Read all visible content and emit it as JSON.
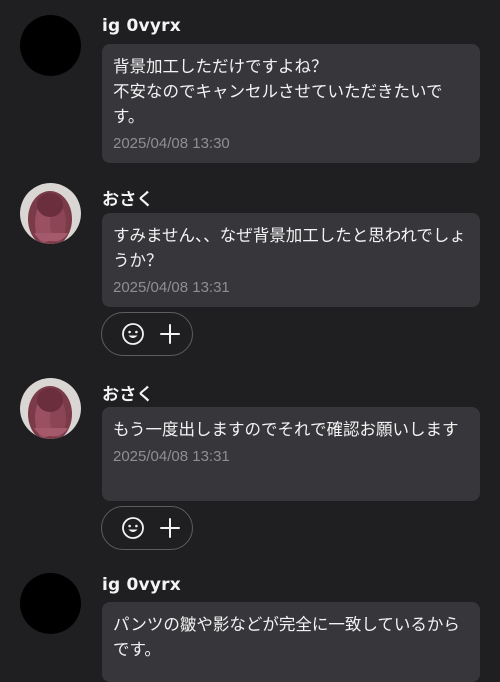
{
  "messages": [
    {
      "sender": "ig 0vyrx",
      "avatar_type": "black-circle",
      "text": "背景加工しただけですよね？\n不安なのでキャンセルさせていただきたいです。",
      "time": "2025/04/08 13:30",
      "reactions": false
    },
    {
      "sender": "おさく",
      "avatar_type": "photo",
      "text": "すみません、、なぜ背景加工したと思われでしょうか？",
      "time": "2025/04/08 13:31",
      "reactions": true
    },
    {
      "sender": "おさく",
      "avatar_type": "photo",
      "text": "もう一度出しますのでそれで確認お願いします",
      "time": "2025/04/08 13:31",
      "reactions": true
    },
    {
      "sender": "ig 0vyrx",
      "avatar_type": "black-circle",
      "text": "パンツの皺や影などが完全に一致しているからです。",
      "time": "",
      "reactions": false
    }
  ],
  "reaction_bar": {
    "icons": [
      "smiley-icon",
      "plus-icon"
    ]
  },
  "colors": {
    "background": "#1f1f21",
    "bubble": "#37373b",
    "timestamp": "#8e8e93",
    "text": "#f3f3f3"
  }
}
